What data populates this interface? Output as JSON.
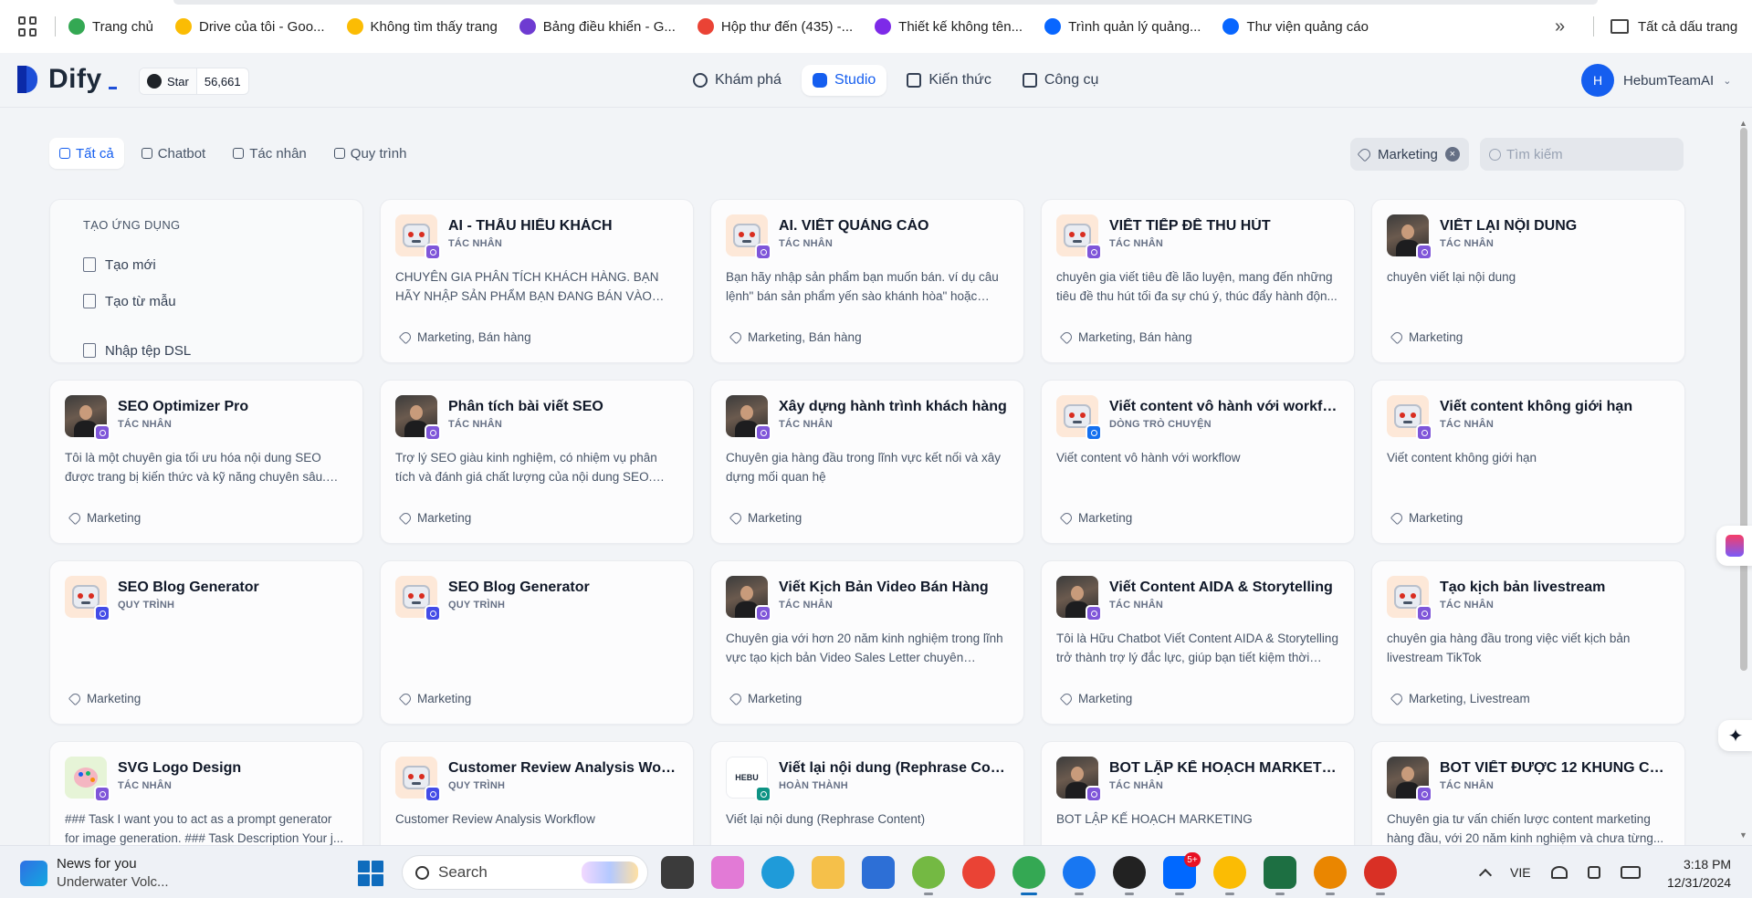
{
  "bookmarks": {
    "items": [
      {
        "label": "Trang chủ",
        "icon": "green-circle-icon",
        "color": "#34a853"
      },
      {
        "label": "Drive của tôi - Goo...",
        "icon": "google-drive-icon",
        "color": "#fbbc04"
      },
      {
        "label": "Không tìm thấy trang",
        "icon": "google-drive-icon",
        "color": "#fbbc04"
      },
      {
        "label": "Bảng điều khiển - G...",
        "icon": "chatgpt-like-icon",
        "color": "#6e3bd1"
      },
      {
        "label": "Hộp thư đến (435) -...",
        "icon": "gmail-icon",
        "color": "#ea4335"
      },
      {
        "label": "Thiết kế không tên...",
        "icon": "canva-heart-icon",
        "color": "#7d2ae8"
      },
      {
        "label": "Trình quản lý quảng...",
        "icon": "meta-icon",
        "color": "#0866ff"
      },
      {
        "label": "Thư viện quảng cáo",
        "icon": "meta-icon",
        "color": "#0866ff"
      }
    ],
    "more": "»",
    "all_bookmarks": "Tất cả dấu trang"
  },
  "header": {
    "logo": "Dify",
    "github": {
      "label": "Star",
      "count": "56,661"
    },
    "nav": [
      {
        "label": "Khám phá",
        "icon": "compass-icon",
        "active": false
      },
      {
        "label": "Studio",
        "icon": "robot-icon",
        "active": true
      },
      {
        "label": "Kiến thức",
        "icon": "book-icon",
        "active": false
      },
      {
        "label": "Công cụ",
        "icon": "hammer-icon",
        "active": false
      }
    ],
    "user": {
      "initial": "H",
      "name": "HebumTeamAI"
    }
  },
  "filters": {
    "tabs": [
      {
        "label": "Tất cả",
        "active": true
      },
      {
        "label": "Chatbot",
        "active": false
      },
      {
        "label": "Tác nhân",
        "active": false
      },
      {
        "label": "Quy trình",
        "active": false
      }
    ],
    "tag_filter": "Marketing",
    "search_placeholder": "Tìm kiếm"
  },
  "create": {
    "title": "TẠO ỨNG DỤNG",
    "new": "Tạo mới",
    "from_template": "Tạo từ mẫu",
    "import_dsl": "Nhập tệp DSL"
  },
  "apps": [
    {
      "name": "AI - THẤU HIỂU KHÁCH",
      "type": "TÁC NHÂN",
      "icon": "robot",
      "badge": "agent",
      "desc": "CHUYÊN GIA PHÂN TÍCH KHÁCH HÀNG. BẠN HÃY NHẬP SẢN PHẨM BẠN ĐANG BÁN VÀO ĐÂY.",
      "tags": "Marketing, Bán hàng"
    },
    {
      "name": "AI. VIẾT QUẢNG CÁO",
      "type": "TÁC NHÂN",
      "icon": "robot",
      "badge": "agent",
      "desc": "Bạn hãy nhập sản phẩm bạn muốn bán. ví dụ câu lệnh\" bán sản phẩm yến sào khánh hòa\" hoặc bạn...",
      "tags": "Marketing, Bán hàng"
    },
    {
      "name": "VIẾT TIẾP ĐỀ THU HÚT",
      "type": "TÁC NHÂN",
      "icon": "robot",
      "badge": "agent",
      "desc": "chuyên gia viết tiêu đề lão luyện, mang đến những tiêu đề thu hút tối đa sự chú ý, thúc đẩy hành độn...",
      "tags": "Marketing, Bán hàng"
    },
    {
      "name": "VIẾT LẠI NỘI DUNG",
      "type": "TÁC NHÂN",
      "icon": "photo",
      "badge": "agent",
      "desc": "chuyên viết lại nội dung",
      "tags": "Marketing"
    },
    {
      "name": "SEO Optimizer Pro",
      "type": "TÁC NHÂN",
      "icon": "photo",
      "badge": "agent",
      "desc": "Tôi là một chuyên gia tối ưu hóa nội dung SEO được trang bị kiến thức và kỹ năng chuyên sâu. Tô...",
      "tags": "Marketing"
    },
    {
      "name": "Phân tích bài viết SEO",
      "type": "TÁC NHÂN",
      "icon": "photo",
      "badge": "agent",
      "desc": "Trợ lý SEO giàu kinh nghiệm, có nhiệm vụ phân tích và đánh giá chất lượng của nội dung SEO. Công...",
      "tags": "Marketing"
    },
    {
      "name": "Xây dựng hành trình khách hàng",
      "type": "TÁC NHÂN",
      "icon": "photo",
      "badge": "agent",
      "desc": "Chuyên gia hàng đầu trong lĩnh vực kết nối và xây dựng mối quan hệ",
      "tags": "Marketing"
    },
    {
      "name": "Viết content vô hành với workflow",
      "type": "DÒNG TRÒ CHUYỆN",
      "icon": "robot",
      "badge": "chat",
      "desc": "Viết content vô hành với workflow",
      "tags": "Marketing"
    },
    {
      "name": "Viết content không giới hạn",
      "type": "TÁC NHÂN",
      "icon": "robot",
      "badge": "agent",
      "desc": "Viết content không giới hạn",
      "tags": "Marketing"
    },
    {
      "name": "SEO Blog Generator",
      "type": "QUY TRÌNH",
      "icon": "robot",
      "badge": "workflow",
      "desc": "",
      "tags": "Marketing"
    },
    {
      "name": "SEO Blog Generator",
      "type": "QUY TRÌNH",
      "icon": "robot",
      "badge": "workflow",
      "desc": "",
      "tags": "Marketing"
    },
    {
      "name": "Viết Kịch Bản Video Bán Hàng",
      "type": "TÁC NHÂN",
      "icon": "photo",
      "badge": "agent",
      "desc": "Chuyên gia với hơn 20 năm kinh nghiệm trong lĩnh vực tạo kịch bản Video Sales Letter chuyên nghiệp...",
      "tags": "Marketing"
    },
    {
      "name": "Viết Content AIDA & Storytelling",
      "type": "TÁC NHÂN",
      "icon": "photo",
      "badge": "agent",
      "desc": "Tôi là Hữu Chatbot Viết Content AIDA & Storytelling trở thành trợ lý đắc lực, giúp bạn tiết kiệm thời gia...",
      "tags": "Marketing"
    },
    {
      "name": "Tạo kịch bản livestream",
      "type": "TÁC NHÂN",
      "icon": "robot",
      "badge": "agent",
      "desc": "chuyên gia hàng đầu trong việc viết kịch bản livestream TikTok",
      "tags": "Marketing, Livestream"
    },
    {
      "name": "SVG Logo Design",
      "type": "TÁC NHÂN",
      "icon": "palette",
      "badge": "agent",
      "desc": "### Task I want you to act as a prompt generator for image generation. ### Task Description Your j...",
      "tags": ""
    },
    {
      "name": "Customer Review Analysis Workfl...",
      "type": "QUY TRÌNH",
      "icon": "robot",
      "badge": "workflow",
      "desc": "Customer Review Analysis Workflow",
      "tags": ""
    },
    {
      "name": "Viết lại nội dung (Rephrase Cont...",
      "type": "HOÀN THÀNH",
      "icon": "hebu",
      "badge": "completion",
      "desc": "Viết lại nội dung (Rephrase Content)",
      "tags": ""
    },
    {
      "name": "BOT LẬP KẾ HOẠCH MARKETING",
      "type": "TÁC NHÂN",
      "icon": "photo",
      "badge": "agent",
      "desc": "BOT LẬP KẾ HOẠCH MARKETING",
      "tags": ""
    },
    {
      "name": "BOT VIẾT ĐƯỢC 12 KHUNG CON...",
      "type": "TÁC NHÂN",
      "icon": "photo",
      "badge": "agent",
      "desc": "Chuyên gia tư vấn chiến lược content marketing hàng đầu, với 20 năm kinh nghiệm và chưa từng...",
      "tags": ""
    }
  ],
  "hebu_icon_text": "HEBU",
  "taskbar": {
    "news_title": "News for you",
    "news_sub": "Underwater Volc...",
    "search_label": "Search",
    "apps": [
      {
        "name": "file-explorer-dark",
        "color": "#3b3b3b"
      },
      {
        "name": "copilot",
        "color": "#e27ad6"
      },
      {
        "name": "edge",
        "color": "#1f9bd9"
      },
      {
        "name": "folder",
        "color": "#f5c04a"
      },
      {
        "name": "store",
        "color": "#2d6fd6"
      },
      {
        "name": "coccoc",
        "color": "#74b943"
      },
      {
        "name": "google",
        "color": "#ea4335"
      },
      {
        "name": "chrome-active",
        "color": "#34a853"
      },
      {
        "name": "facebook",
        "color": "#1877f2"
      },
      {
        "name": "chatgpt",
        "color": "#222222"
      },
      {
        "name": "zalo",
        "color": "#0068ff"
      },
      {
        "name": "chrome-profile",
        "color": "#fbbc04"
      },
      {
        "name": "excel",
        "color": "#1d6f42"
      },
      {
        "name": "chrome-m",
        "color": "#ea8600"
      },
      {
        "name": "chrome-n",
        "color": "#d93025"
      }
    ],
    "zalo_badge": "5+",
    "lang": "VIE",
    "time": "3:18 PM",
    "date": "12/31/2024"
  }
}
